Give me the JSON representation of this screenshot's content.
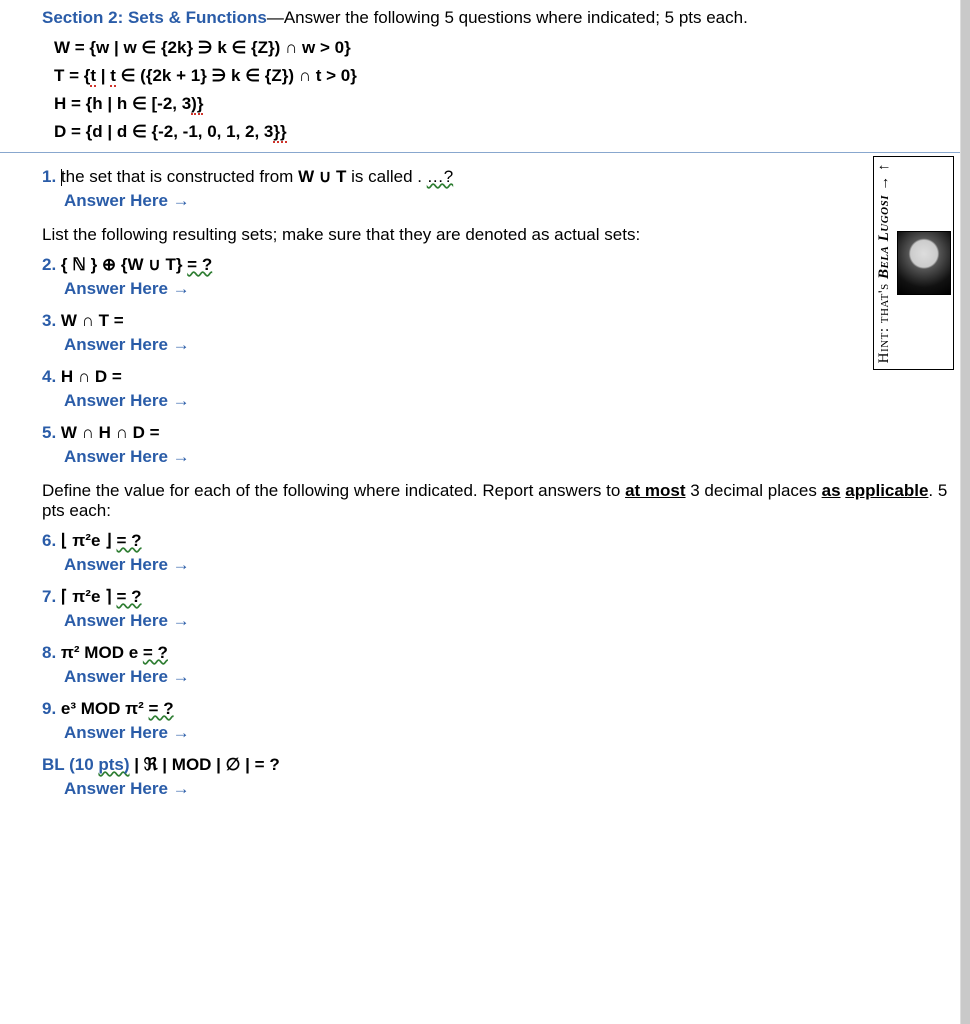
{
  "section": {
    "title": "Section 2: Sets & Functions",
    "subtitle": "—Answer the following 5 questions where indicated; 5 pts each."
  },
  "definitions": {
    "W": "W = {w | w ∈ {2k} ∋ k ∈ {Z}) ∩ w > 0}",
    "T_prefix": "T = {",
    "T_t1": "t",
    "T_mid": " | ",
    "T_t2": "t",
    "T_suffix": " ∈ ({2k + 1} ∋ k ∈ {Z}) ∩ t > 0}",
    "H_prefix": "H = {h | h ∈ [-2, 3",
    "H_suffix": ")}",
    "D_prefix": "D = {d | d ∈ {-2, -1, 0, 1, 2, 3",
    "D_suffix": "}}"
  },
  "q1": {
    "num": "1. ",
    "text_a": "the set that is constructed from ",
    "wut": "W ∪ T",
    "text_b": " is called . ",
    "dots": "…?"
  },
  "answer_here": "Answer Here →",
  "instruction1": "List the following resulting sets; make sure that they are denoted as actual sets:",
  "q2": {
    "num": "2.",
    "text_a": " { ℕ } ⊕ {W ∪ T} ",
    "eqq": "= ?"
  },
  "q3": {
    "num": "3.",
    "text": "  W ∩ T ="
  },
  "q4": {
    "num": "4.",
    "text": "  H ∩ D ="
  },
  "q5": {
    "num": "5.",
    "text": "  W ∩ H ∩ D ="
  },
  "instruction2a": "Define the value for each of the following where indicated.  Report answers to ",
  "instruction2_atmost": "at most",
  "instruction2b": " 3 decimal places ",
  "instruction2_as": "as",
  "instruction2_sp": " ",
  "instruction2_applicable": "applicable",
  "instruction2c": ".  5 pts each:",
  "q6": {
    "num": "6.",
    "text_a": "  ⌊ π²e ⌋ ",
    "eqq": "= ?"
  },
  "q7": {
    "num": "7.",
    "text_a": "  ⌈ π²e ⌉ ",
    "eqq": "= ?"
  },
  "q8": {
    "num": "8.",
    "text_a": "  π² MOD e ",
    "eqq": "= ?"
  },
  "q9": {
    "num": "9.",
    "text_a": "  e³ MOD π² ",
    "eqq": "= ?"
  },
  "bl": {
    "label_a": "BL (10 ",
    "label_pts": "pts)",
    "mid": "   | ℜ | MOD | ∅ |  = ?"
  },
  "hint": {
    "prefix": "Hint: that's ",
    "name": "Bela Lugosi",
    "arrow": " → ↑"
  }
}
